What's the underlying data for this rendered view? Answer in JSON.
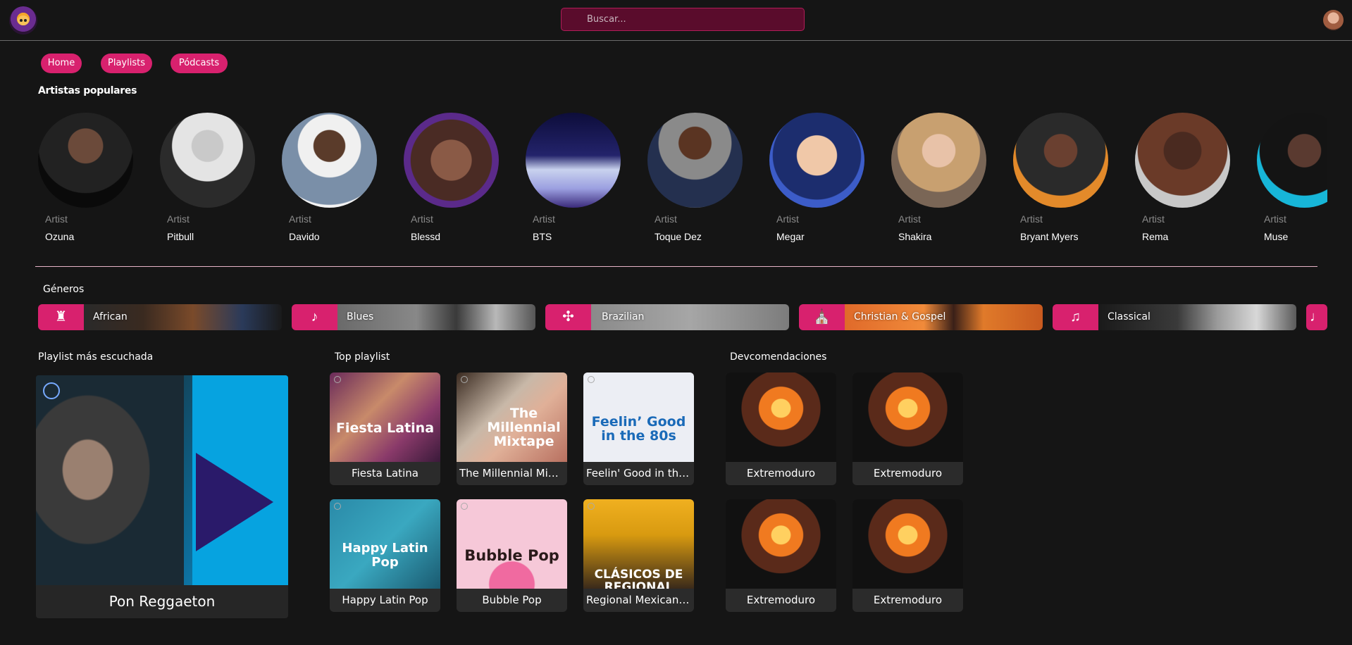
{
  "header": {
    "search_placeholder": "Buscar..."
  },
  "nav": {
    "home": "Home",
    "playlists": "Playlists",
    "podcasts": "Pódcasts"
  },
  "artists_section": {
    "title": "Artistas populares",
    "items": [
      {
        "kind": "Artist",
        "name": "Ozuna"
      },
      {
        "kind": "Artist",
        "name": "Pitbull"
      },
      {
        "kind": "Artist",
        "name": "Davido"
      },
      {
        "kind": "Artist",
        "name": "Blessd"
      },
      {
        "kind": "Artist",
        "name": "BTS"
      },
      {
        "kind": "Artist",
        "name": "Toque Dez"
      },
      {
        "kind": "Artist",
        "name": "Megar"
      },
      {
        "kind": "Artist",
        "name": "Shakira"
      },
      {
        "kind": "Artist",
        "name": "Bryant Myers"
      },
      {
        "kind": "Artist",
        "name": "Rema"
      },
      {
        "kind": "Artist",
        "name": "Muse"
      }
    ]
  },
  "genres_section": {
    "title": "Géneros",
    "items": [
      {
        "label": "African",
        "icon": "african-drum-icon"
      },
      {
        "label": "Blues",
        "icon": "guitar-icon"
      },
      {
        "label": "Brazilian",
        "icon": "maracas-icon"
      },
      {
        "label": "Christian & Gospel",
        "icon": "church-icon"
      },
      {
        "label": "Classical",
        "icon": "piano-icon"
      }
    ]
  },
  "most_played": {
    "title": "Playlist más escuchada",
    "name": "Pon Reggaeton"
  },
  "top_playlist": {
    "title": "Top playlist",
    "items": [
      {
        "name": "Fiesta Latina",
        "cover_text": "Fiesta Latina"
      },
      {
        "name": "The Millennial Mixtape",
        "cover_text": "The Millennial Mixtape"
      },
      {
        "name": "Feelin' Good in the 80s",
        "cover_text": "Feelin’ Good in the 80s"
      },
      {
        "name": "Happy Latin Pop",
        "cover_text": "Happy Latin Pop"
      },
      {
        "name": "Bubble Pop",
        "cover_text": "Bubble Pop"
      },
      {
        "name": "Regional Mexican Classics",
        "cover_text": "CLÁSICOS DE REGIONAL"
      }
    ]
  },
  "recommendations": {
    "title": "Devcomendaciones",
    "items": [
      {
        "name": "Extremoduro"
      },
      {
        "name": "Extremoduro"
      },
      {
        "name": "Extremoduro"
      },
      {
        "name": "Extremoduro"
      }
    ]
  }
}
